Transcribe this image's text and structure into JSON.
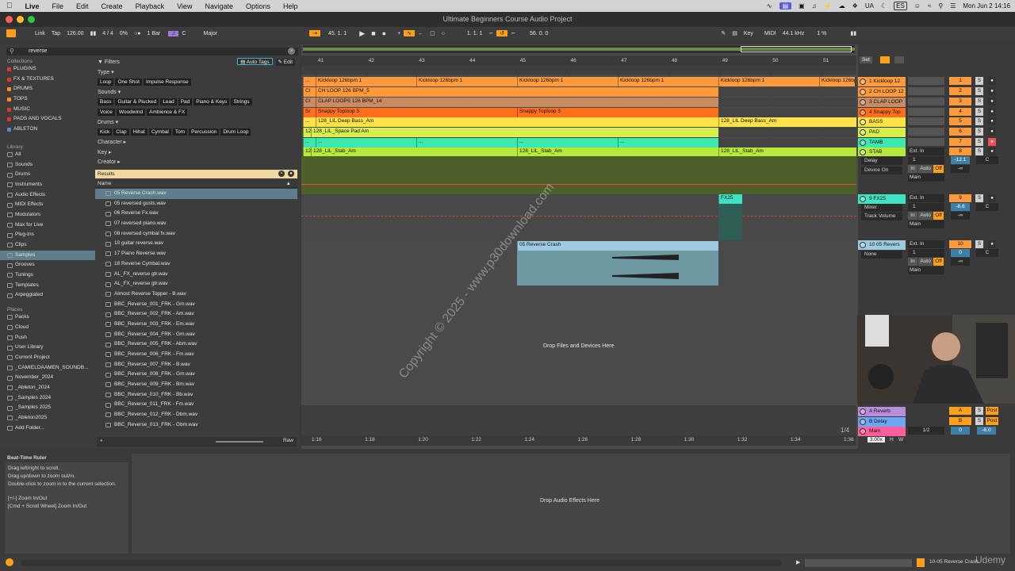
{
  "menubar": {
    "items": [
      "Live",
      "File",
      "Edit",
      "Create",
      "Playback",
      "View",
      "Navigate",
      "Options",
      "Help"
    ],
    "status": {
      "lang": "UA",
      "input": "ES",
      "datetime": "Mon Jun 2  14:16"
    }
  },
  "window": {
    "title": "Ultimate Beginners Course Audio Project"
  },
  "control": {
    "link": "Link",
    "tap": "Tap",
    "tempo": "126.00",
    "meter": "4 / 4",
    "percent": "0%",
    "quant": "1 Bar",
    "key_label": "C",
    "scale": "Major",
    "position": "45.  1.  1",
    "loop_start": "1.  1.  1",
    "loop_len": "56.  0.  0",
    "key": "Key",
    "midi": "MIDI",
    "samplerate": "44.1 kHz",
    "cpu": "1 %"
  },
  "browser": {
    "search": "reverse",
    "collections_title": "Collections",
    "collections": [
      {
        "label": "PLUGINS",
        "color": "#e0362b"
      },
      {
        "label": "FX & TEXTURES",
        "color": "#e0362b"
      },
      {
        "label": "DRUMS",
        "color": "#ff8c1a"
      },
      {
        "label": "TOPS",
        "color": "#ff8c1a"
      },
      {
        "label": "MUSIC",
        "color": "#e0362b"
      },
      {
        "label": "PADS AND VOCALS",
        "color": "#e0362b"
      },
      {
        "label": "ABLETON",
        "color": "#4c8bd9"
      }
    ],
    "library_title": "Library",
    "library": [
      "All",
      "Sounds",
      "Drums",
      "Instruments",
      "Audio Effects",
      "MIDI Effects",
      "Modulators",
      "Max for Live",
      "Plug-Ins",
      "Clips",
      "Samples",
      "Grooves",
      "Tunings",
      "Templates",
      "Arpeggiated"
    ],
    "places_title": "Places",
    "places": [
      "Packs",
      "Cloud",
      "Push",
      "User Library",
      "Current Project",
      "_CAMIELDAAMEN_SOUNDB...",
      "November_2024",
      "_Ableton_2024",
      "_Samples 2024",
      "_Samples 2025",
      "_Ableton2025",
      "Add Folder..."
    ],
    "filters_label": "Filters",
    "auto_tags": "Auto Tags",
    "edit": "Edit",
    "type_label": "Type",
    "type_tags": [
      "Loop",
      "One Shot",
      "Impulse Response"
    ],
    "sounds_label": "Sounds",
    "sounds_tags1": [
      "Bass",
      "Guitar & Plucked",
      "Lead",
      "Pad",
      "Piano & Keys",
      "Strings"
    ],
    "sounds_tags2": [
      "Voice",
      "Woodwind",
      "Ambience & FX"
    ],
    "drums_label": "Drums",
    "drums_tags": [
      "Kick",
      "Clap",
      "Hihat",
      "Cymbal",
      "Tom",
      "Percussion",
      "Drum Loop"
    ],
    "character_label": "Character",
    "key_label": "Key",
    "creator_label": "Creator",
    "results_label": "Results",
    "name_label": "Name",
    "raw": "Raw",
    "results": [
      "05 Reverse Crash.wav",
      "05 reversed gusts.wav",
      "06 Reverse Fx.wav",
      "07 reversed piano.wav",
      "08 reversed cymbal fx.wav",
      "10 guitar reverse.wav",
      "17 Piano Reverse.wav",
      "18 Reverse Cymbal.wav",
      "AL_FX_reverse gtr.wav",
      "AL_FX_reverse gtr.wav",
      "Almost Reverse Topper - B.wav",
      "BBC_Reverse_001_FRK - Gm.wav",
      "BBC_Reverse_002_FRK - Am.wav",
      "BBC_Reverse_003_FRK - Em.wav",
      "BBC_Reverse_004_FRK - Gm.wav",
      "BBC_Reverse_005_FRK - Abm.wav",
      "BBC_Reverse_006_FRK - Fm.wav",
      "BBC_Reverse_007_FRK - B.wav",
      "BBC_Reverse_008_FRK - Gm.wav",
      "BBC_Reverse_009_FRK - Bm.wav",
      "BBC_Reverse_010_FRK - Bb.wav",
      "BBC_Reverse_011_FRK - Fm.wav",
      "BBC_Reverse_012_FRK - Dbm.wav",
      "BBC_Reverse_013_FRK - Gbm.wav"
    ]
  },
  "ruler": {
    "bars": [
      "41",
      "42",
      "43",
      "44",
      "45",
      "46",
      "47",
      "48",
      "49",
      "50",
      "51"
    ],
    "time": [
      "1:16",
      "1:18",
      "1:20",
      "1:22",
      "1:24",
      "1:26",
      "1:28",
      "1:30",
      "1:32",
      "1:34",
      "1:36"
    ],
    "set": "Set"
  },
  "clips": {
    "kick": "Kickloop 126bpm 1",
    "ch": "CH LOOP 126 BPM_5",
    "ch_short": "Cl",
    "clap": "CLAP LOOPS 126 BPM_14",
    "snappy": "Snappy Toploop 3",
    "snappy_short": "Sr",
    "bass": "128_LIL Deep Bass_Am",
    "pad": "128_LIL_Space Pad Am",
    "stab": "128_LIL_Stab_Am",
    "twelve": "12",
    "fx25": "FX25",
    "crash": "05 Reverse Crash",
    "ellipsis": "..."
  },
  "tracks": [
    {
      "name": "1 Kickloop 12",
      "color": "#ff9a3c",
      "num": "1"
    },
    {
      "name": "2 CH LOOP 12",
      "color": "#ff9a3c",
      "num": "2"
    },
    {
      "name": "3 CLAP LOOP",
      "color": "#c98c62",
      "num": "3"
    },
    {
      "name": "4 Snappy Top",
      "color": "#ff6f1e",
      "num": "4"
    },
    {
      "name": "BASS",
      "color": "#ffe14a",
      "num": "5"
    },
    {
      "name": "PAD",
      "color": "#d8ef4a",
      "num": "6"
    },
    {
      "name": "TAMB",
      "color": "#3de7b0",
      "num": "7"
    },
    {
      "name": "STAB",
      "color": "#b8e83a",
      "num": "8"
    }
  ],
  "devices": {
    "delay": "Delay",
    "device_on": "Device On",
    "fx25_track": "9 FX25",
    "mixer": "Mixer",
    "track_volume": "Track Volume",
    "rev_track": "10 05 Revers",
    "none": "None",
    "ext_in": "Ext. In",
    "ch1": "1",
    "in": "In",
    "auto": "Auto",
    "off": "Off",
    "main": "Main",
    "inf": "-∞",
    "c": "C",
    "vol1": "-12.1",
    "vol2": "-8.6",
    "vol3": "0",
    "num9": "9",
    "num10": "10",
    "s": "S"
  },
  "returns": [
    {
      "name": "A Reverb",
      "letter": "A",
      "color": "#b98dd9"
    },
    {
      "name": "B Delay",
      "letter": "B",
      "color": "#6fa6f2"
    },
    {
      "name": "Main",
      "letter": "",
      "color": "#ff5f9a"
    }
  ],
  "main_mix": {
    "frac": "1/2",
    "zero": "0",
    "neg6": "-6.0",
    "post": "Post",
    "quarter": "1/4",
    "zoom": "3.00x",
    "h": "H",
    "w": "W"
  },
  "drop_files": "Drop Files and Devices Here",
  "info": {
    "title": "Beat-Time Ruler",
    "lines": [
      "Drag left/right to scroll.",
      "Drag up/down to zoom out/in.",
      "Double-click to zoom in to the current selection.",
      "",
      "[+/-] Zoom In/Out",
      "[Cmd + Scroll Wheel] Zoom In/Out"
    ]
  },
  "drop_effects": "Drop Audio Effects Here",
  "status_clip": "10-05 Reverse Crash",
  "watermark": "Copyright © 2025 - www.p30download.com",
  "udemy": "Udemy"
}
